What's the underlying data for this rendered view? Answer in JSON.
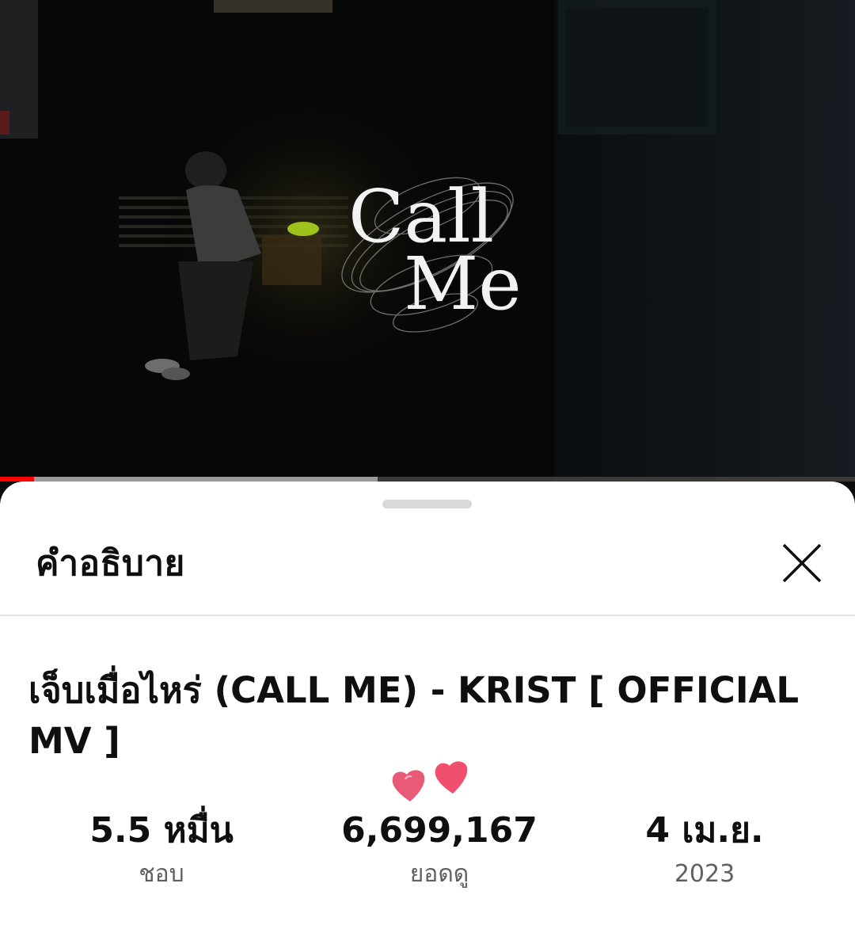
{
  "video": {
    "overlay_title_line1": "Call",
    "overlay_title_line2": "Me",
    "progress": {
      "played_fraction": 0.04,
      "buffered_fraction": 0.442
    },
    "accent_color": "#ff0000"
  },
  "sheet": {
    "title": "คำอธิบาย",
    "close_icon": "close-icon"
  },
  "description": {
    "video_title": "เจ็บเมื่อไหร่ (CALL ME) - KRIST [ OFFICIAL MV ]",
    "stats": {
      "likes": {
        "value": "5.5 หมื่น",
        "label": "ชอบ"
      },
      "views": {
        "value": "6,699,167",
        "label": "ยอดดู"
      },
      "date": {
        "value": "4 เม.ย.",
        "label": "2023"
      }
    },
    "decoration_icon": "hearts-icon"
  }
}
